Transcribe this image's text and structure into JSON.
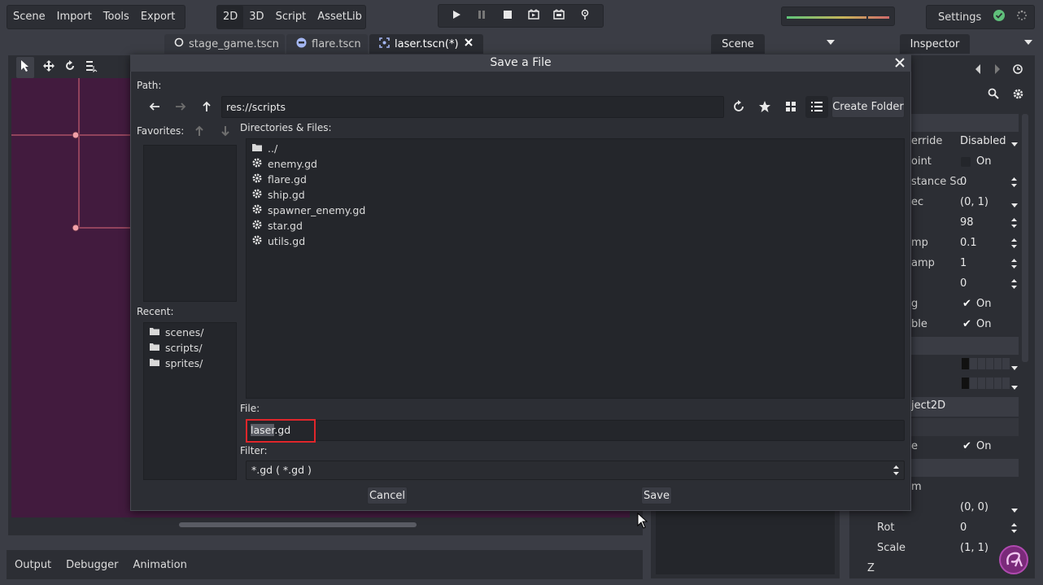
{
  "menus": {
    "main": [
      "Scene",
      "Import",
      "Tools",
      "Export"
    ],
    "modes": [
      "2D",
      "3D",
      "Script",
      "AssetLib"
    ],
    "active_mode": "2D"
  },
  "settings": {
    "label": "Settings"
  },
  "scene_tabs": [
    {
      "label": "stage_game.tscn",
      "icon": "circle-node-icon"
    },
    {
      "label": "flare.tscn",
      "icon": "sprite-node-icon"
    },
    {
      "label": "laser.tscn(*)",
      "icon": "node2d-icon",
      "active": true
    }
  ],
  "bottom_tabs": [
    "Output",
    "Debugger",
    "Animation"
  ],
  "docks": {
    "scene": "Scene",
    "inspector": "Inspector"
  },
  "inspector": {
    "rows": [
      {
        "label": "erride",
        "value": "Disabled"
      },
      {
        "label": "oint",
        "value": "On"
      },
      {
        "label": "stance Sc",
        "value": "0"
      },
      {
        "label": "ec",
        "value": "(0, 1)"
      },
      {
        "label": "",
        "value": "98"
      },
      {
        "label": "mp",
        "value": "0.1"
      },
      {
        "label": "amp",
        "value": "1"
      },
      {
        "label": "",
        "value": "0"
      },
      {
        "label": "g",
        "value": "On"
      },
      {
        "label": "ble",
        "value": "On"
      }
    ],
    "section": "ject2D",
    "row_e": {
      "label": "e",
      "value": "On"
    },
    "row_m": {
      "label": "m"
    },
    "pos": {
      "label": "",
      "value": "(0, 0)"
    },
    "rot": {
      "label": "Rot",
      "value": "0"
    },
    "scale": {
      "label": "Scale",
      "value": "(1, 1)"
    },
    "z": {
      "label": "Z"
    }
  },
  "dialog": {
    "title": "Save a File",
    "path_label": "Path:",
    "path_value": "res://scripts",
    "create_folder": "Create Folder",
    "favorites_label": "Favorites:",
    "recent_label": "Recent:",
    "recent": [
      "scenes/",
      "scripts/",
      "sprites/"
    ],
    "files_label": "Directories & Files:",
    "files": [
      {
        "name": "../",
        "kind": "folder"
      },
      {
        "name": "enemy.gd",
        "kind": "script"
      },
      {
        "name": "flare.gd",
        "kind": "script"
      },
      {
        "name": "ship.gd",
        "kind": "script"
      },
      {
        "name": "spawner_enemy.gd",
        "kind": "script"
      },
      {
        "name": "star.gd",
        "kind": "script"
      },
      {
        "name": "utils.gd",
        "kind": "script"
      }
    ],
    "file_label": "File:",
    "file_selected": "laser",
    "file_rest": ".gd",
    "filter_label": "Filter:",
    "filter_value": "*.gd ( *.gd )",
    "cancel": "Cancel",
    "save": "Save"
  },
  "colors": {
    "accent_red": "#e0262b",
    "canvas": "#421b3e",
    "guide": "#e06b7a"
  }
}
